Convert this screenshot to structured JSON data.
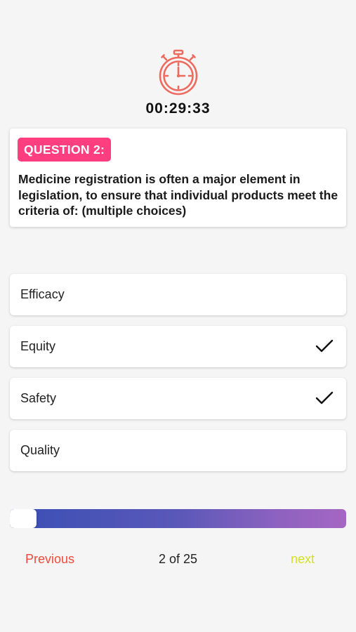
{
  "timer": {
    "icon": "stopwatch-icon",
    "value": "00:29:33"
  },
  "question": {
    "badge": "QUESTION 2:",
    "text": "Medicine registration is often a major element in legislation, to ensure that individual products meet the criteria of: (multiple choices)"
  },
  "options": [
    {
      "label": "Efficacy",
      "selected": false
    },
    {
      "label": "Equity",
      "selected": true
    },
    {
      "label": "Safety",
      "selected": true
    },
    {
      "label": "Quality",
      "selected": false
    }
  ],
  "progress": {
    "current": 2,
    "total": 25,
    "label": "2 of 25"
  },
  "nav": {
    "previous_label": "Previous",
    "next_label": "next"
  },
  "colors": {
    "accent_badge": "#ff3e7f",
    "timer_icon": "#ee6a5e",
    "previous": "#f04a3a",
    "next": "#d4e21e",
    "progress_start": "#3a4fb5",
    "progress_end": "#a467c2"
  }
}
